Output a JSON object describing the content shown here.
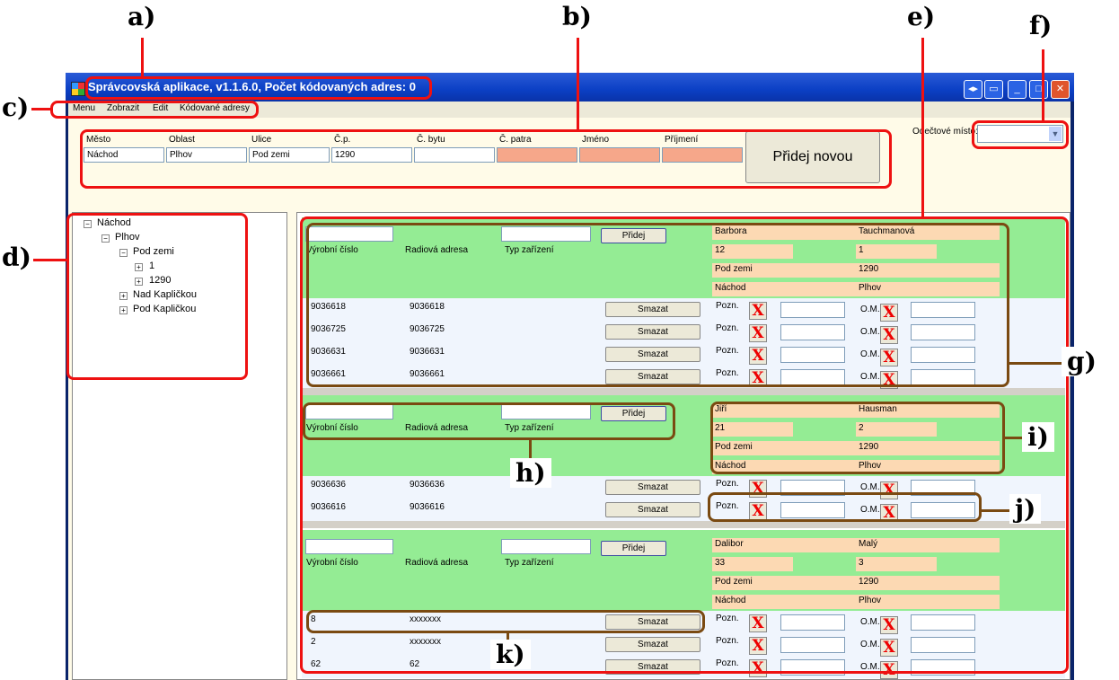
{
  "window": {
    "title": "Správcovská aplikace, v1.1.6.0, Počet kódovaných adres: 0",
    "controls": [
      "◂▸",
      "▭",
      "_",
      "□",
      "✕"
    ]
  },
  "menu": [
    "Menu",
    "Zobrazit",
    "Edit",
    "Kódované adresy"
  ],
  "address_form": {
    "labels": [
      "Město",
      "Oblast",
      "Ulice",
      "Č.p.",
      "Č. bytu",
      "Č. patra",
      "Jméno",
      "Příjmení"
    ],
    "values": [
      "Náchod",
      "Plhov",
      "Pod zemi",
      "1290",
      "",
      "",
      "",
      ""
    ],
    "add_button": "Přidej novou",
    "reading_place_label": "Odečtové místo:",
    "reading_place_value": ""
  },
  "tree": {
    "root": "Náchod",
    "area": "Plhov",
    "street": "Pod zemi",
    "children": [
      "1",
      "1290"
    ],
    "streets": [
      "Nad Kapličkou",
      "Pod Kapličkou"
    ]
  },
  "device_header": {
    "col1": "Výrobní číslo",
    "col2": "Radiová adresa",
    "col3": "Typ zařízení",
    "add": "Přidej",
    "delete": "Smazat",
    "note": "Pozn.",
    "om": "O.M.",
    "x": "X"
  },
  "groups": [
    {
      "person": [
        "Barbora",
        "Tauchmanová",
        "12",
        "1",
        "Pod zemi",
        "1290",
        "Náchod",
        "Plhov"
      ],
      "devices": [
        [
          "9036618",
          "9036618"
        ],
        [
          "9036725",
          "9036725"
        ],
        [
          "9036631",
          "9036631"
        ],
        [
          "9036661",
          "9036661"
        ]
      ]
    },
    {
      "person": [
        "Jiří",
        "Hausman",
        "21",
        "2",
        "Pod zemi",
        "1290",
        "Náchod",
        "Plhov"
      ],
      "devices": [
        [
          "9036636",
          "9036636"
        ],
        [
          "9036616",
          "9036616"
        ]
      ]
    },
    {
      "person": [
        "Dalibor",
        "Malý",
        "33",
        "3",
        "Pod zemi",
        "1290",
        "Náchod",
        "Plhov"
      ],
      "devices": [
        [
          "8",
          "xxxxxxx"
        ],
        [
          "2",
          "xxxxxxx"
        ],
        [
          "62",
          "62"
        ]
      ]
    }
  ],
  "annotations": [
    "a)",
    "b)",
    "c)",
    "d)",
    "e)",
    "f)",
    "g)",
    "h)",
    "i)",
    "j)",
    "k)"
  ]
}
